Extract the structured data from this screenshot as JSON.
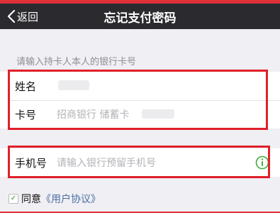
{
  "nav": {
    "back_label": "返回",
    "title": "忘记支付密码"
  },
  "form": {
    "hint": "请输入持卡人本人的银行卡号",
    "name_label": "姓名",
    "card_label": "卡号",
    "card_value": "招商银行 储蓄卡",
    "phone_label": "手机号",
    "phone_placeholder": "请输入银行预留手机号"
  },
  "agreement": {
    "text": "同意",
    "link": "《用户协议》"
  },
  "colors": {
    "nav_bg": "#2b2b2f",
    "highlight_red": "#e0202a",
    "info_green": "#3fae3a",
    "link_blue": "#4a6fa0"
  }
}
